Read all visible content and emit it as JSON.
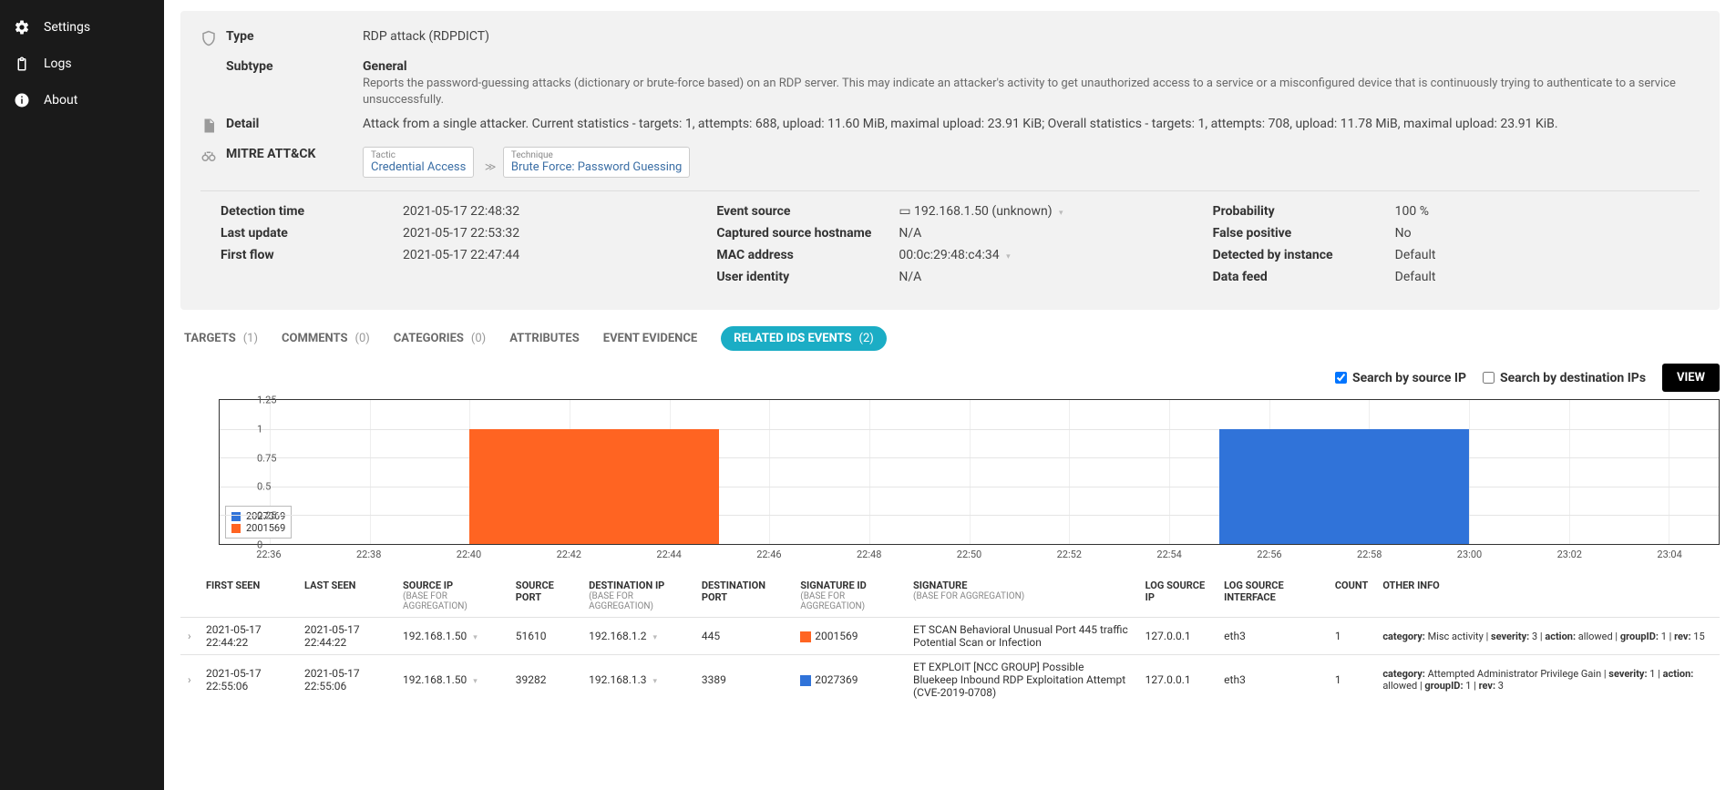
{
  "sidebar": {
    "items": [
      {
        "label": "Settings",
        "icon": "gear"
      },
      {
        "label": "Logs",
        "icon": "clipboard"
      },
      {
        "label": "About",
        "icon": "info"
      }
    ]
  },
  "header": {
    "type_label": "Type",
    "type_value": "RDP attack (RDPDICT)",
    "subtype_label": "Subtype",
    "subtype_title": "General",
    "subtype_desc": "Reports the password-guessing attacks (dictionary or brute-force based) on an RDP server. This may indicate an attacker's activity to get unauthorized access to a service or a misconfigured device that is continuously trying to authenticate to a service unsuccessfully.",
    "detail_label": "Detail",
    "detail_value": "Attack from a single attacker. Current statistics - targets: 1, attempts: 688, upload: 11.60 MiB, maximal upload: 23.91 KiB; Overall statistics - targets: 1, attempts: 708, upload: 11.78 MiB, maximal upload: 23.91 KiB.",
    "mitre_label": "MITRE ATT&CK",
    "mitre_tactic_title": "Tactic",
    "mitre_tactic_value": "Credential Access",
    "mitre_technique_title": "Technique",
    "mitre_technique_value": "Brute Force: Password Guessing"
  },
  "details": {
    "col1": [
      {
        "label": "Detection time",
        "value": "2021-05-17 22:48:32"
      },
      {
        "label": "Last update",
        "value": "2021-05-17 22:53:32"
      },
      {
        "label": "First flow",
        "value": "2021-05-17 22:47:44"
      }
    ],
    "col2": [
      {
        "label": "Event source",
        "value": "192.168.1.50 (unknown)"
      },
      {
        "label": "Captured source hostname",
        "value": "N/A"
      },
      {
        "label": "MAC address",
        "value": "00:0c:29:48:c4:34"
      },
      {
        "label": "User identity",
        "value": "N/A"
      }
    ],
    "col3": [
      {
        "label": "Probability",
        "value": "100 %"
      },
      {
        "label": "False positive",
        "value": "No"
      },
      {
        "label": "Detected by instance",
        "value": "Default"
      },
      {
        "label": "Data feed",
        "value": "Default"
      }
    ]
  },
  "tabs": [
    {
      "label": "TARGETS",
      "count": "(1)"
    },
    {
      "label": "COMMENTS",
      "count": "(0)"
    },
    {
      "label": "CATEGORIES",
      "count": "(0)"
    },
    {
      "label": "ATTRIBUTES",
      "count": ""
    },
    {
      "label": "EVENT EVIDENCE",
      "count": ""
    },
    {
      "label": "RELATED IDS EVENTS",
      "count": "(2)",
      "active": true
    }
  ],
  "controls": {
    "search_source": "Search by source IP",
    "search_dest": "Search by destination IPs",
    "view": "VIEW"
  },
  "chart_data": {
    "type": "bar",
    "ylim": [
      0,
      1.25
    ],
    "yticks": [
      0,
      0.25,
      0.5,
      0.75,
      1,
      1.25
    ],
    "x_range": [
      "22:35",
      "23:05"
    ],
    "xticks": [
      "22:36",
      "22:38",
      "22:40",
      "22:42",
      "22:44",
      "22:46",
      "22:48",
      "22:50",
      "22:52",
      "22:54",
      "22:56",
      "22:58",
      "23:00",
      "23:02",
      "23:04"
    ],
    "series": [
      {
        "name": "2027369",
        "color": "blue",
        "bars": [
          {
            "x_start": "22:55",
            "x_end": "23:00",
            "value": 1
          }
        ]
      },
      {
        "name": "2001569",
        "color": "orange",
        "bars": [
          {
            "x_start": "22:40",
            "x_end": "22:45",
            "value": 1
          }
        ]
      }
    ],
    "legend": [
      "2027369",
      "2001569"
    ]
  },
  "table": {
    "columns": [
      "FIRST SEEN",
      "LAST SEEN",
      "SOURCE IP",
      "SOURCE PORT",
      "DESTINATION IP",
      "DESTINATION PORT",
      "SIGNATURE ID",
      "SIGNATURE",
      "LOG SOURCE IP",
      "LOG SOURCE INTERFACE",
      "COUNT",
      "OTHER INFO"
    ],
    "base_agg": "(BASE FOR AGGREGATION)",
    "rows": [
      {
        "first_seen": "2021-05-17 22:44:22",
        "last_seen": "2021-05-17 22:44:22",
        "src_ip": "192.168.1.50",
        "src_port": "51610",
        "dst_ip": "192.168.1.2",
        "dst_port": "445",
        "sig_id": "2001569",
        "sig_color": "orange",
        "signature": "ET SCAN Behavioral Unusual Port 445 traffic Potential Scan or Infection",
        "log_ip": "127.0.0.1",
        "log_if": "eth3",
        "count": "1",
        "other": "category: Misc activity | severity: 3 | action: allowed | groupID: 1 | rev: 15"
      },
      {
        "first_seen": "2021-05-17 22:55:06",
        "last_seen": "2021-05-17 22:55:06",
        "src_ip": "192.168.1.50",
        "src_port": "39282",
        "dst_ip": "192.168.1.3",
        "dst_port": "3389",
        "sig_id": "2027369",
        "sig_color": "blue",
        "signature": "ET EXPLOIT [NCC GROUP] Possible Bluekeep Inbound RDP Exploitation Attempt (CVE-2019-0708)",
        "log_ip": "127.0.0.1",
        "log_if": "eth3",
        "count": "1",
        "other": "category: Attempted Administrator Privilege Gain | severity: 1 | action: allowed | groupID: 1 | rev: 3"
      }
    ]
  }
}
